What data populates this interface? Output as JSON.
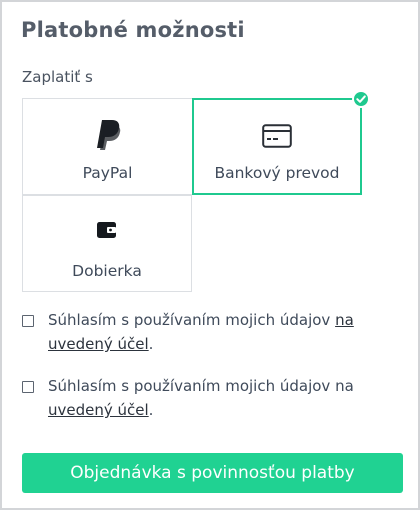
{
  "panel": {
    "title": "Platobné možnosti"
  },
  "payment": {
    "pay_with_label": "Zaplatiť s",
    "options": [
      {
        "label": "PayPal",
        "icon": "paypal-icon",
        "selected": false
      },
      {
        "label": "Bankový prevod",
        "icon": "credit-card-icon",
        "selected": true
      },
      {
        "label": "Dobierka",
        "icon": "wallet-icon",
        "selected": false
      }
    ]
  },
  "consents": [
    {
      "text": "Súhlasím s používaním mojich údajov",
      "link": "na uvedený účel",
      "after": ".",
      "checked": false
    },
    {
      "text": "Súhlasím s používaním mojich údajov na",
      "link": "uvedený účel",
      "after": ".",
      "checked": false
    }
  ],
  "submit": {
    "label": "Objednávka s povinnosťou platby"
  },
  "colors": {
    "accent": "#1fc98f",
    "button": "#20d292",
    "text": "#3f4a5a",
    "border": "#dcdfe3"
  }
}
